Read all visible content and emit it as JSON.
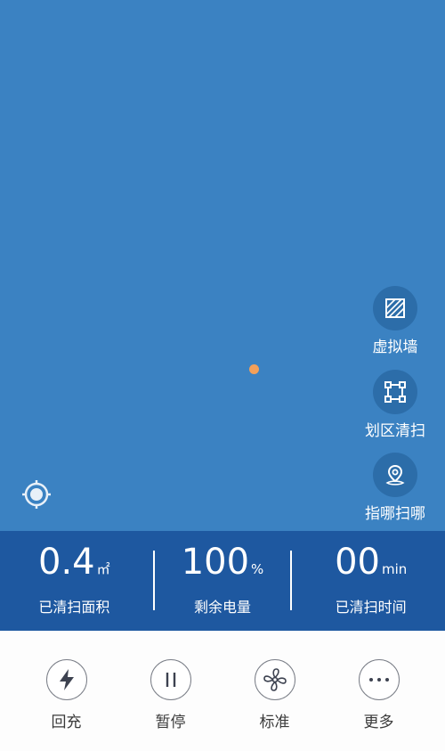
{
  "map": {
    "background_color": "#3b82c2",
    "robot_color": "#f2a05a"
  },
  "map_tools": [
    {
      "label": "虚拟墙",
      "icon": "virtual-wall-icon"
    },
    {
      "label": "划区清扫",
      "icon": "zone-clean-icon"
    },
    {
      "label": "指哪扫哪",
      "icon": "spot-clean-pin-icon"
    }
  ],
  "stats": [
    {
      "value": "0.4",
      "unit": "㎡",
      "caption": "已清扫面积"
    },
    {
      "value": "100",
      "unit": "%",
      "caption": "剩余电量"
    },
    {
      "value": "00",
      "unit": "min",
      "caption": "已清扫时间"
    }
  ],
  "actions": [
    {
      "label": "回充",
      "icon": "lightning-icon"
    },
    {
      "label": "暂停",
      "icon": "pause-icon"
    },
    {
      "label": "标准",
      "icon": "fan-icon"
    },
    {
      "label": "更多",
      "icon": "more-dots-icon"
    }
  ],
  "colors": {
    "stats_bar": "#1e58a0",
    "tool_button": "#2c6da9"
  }
}
